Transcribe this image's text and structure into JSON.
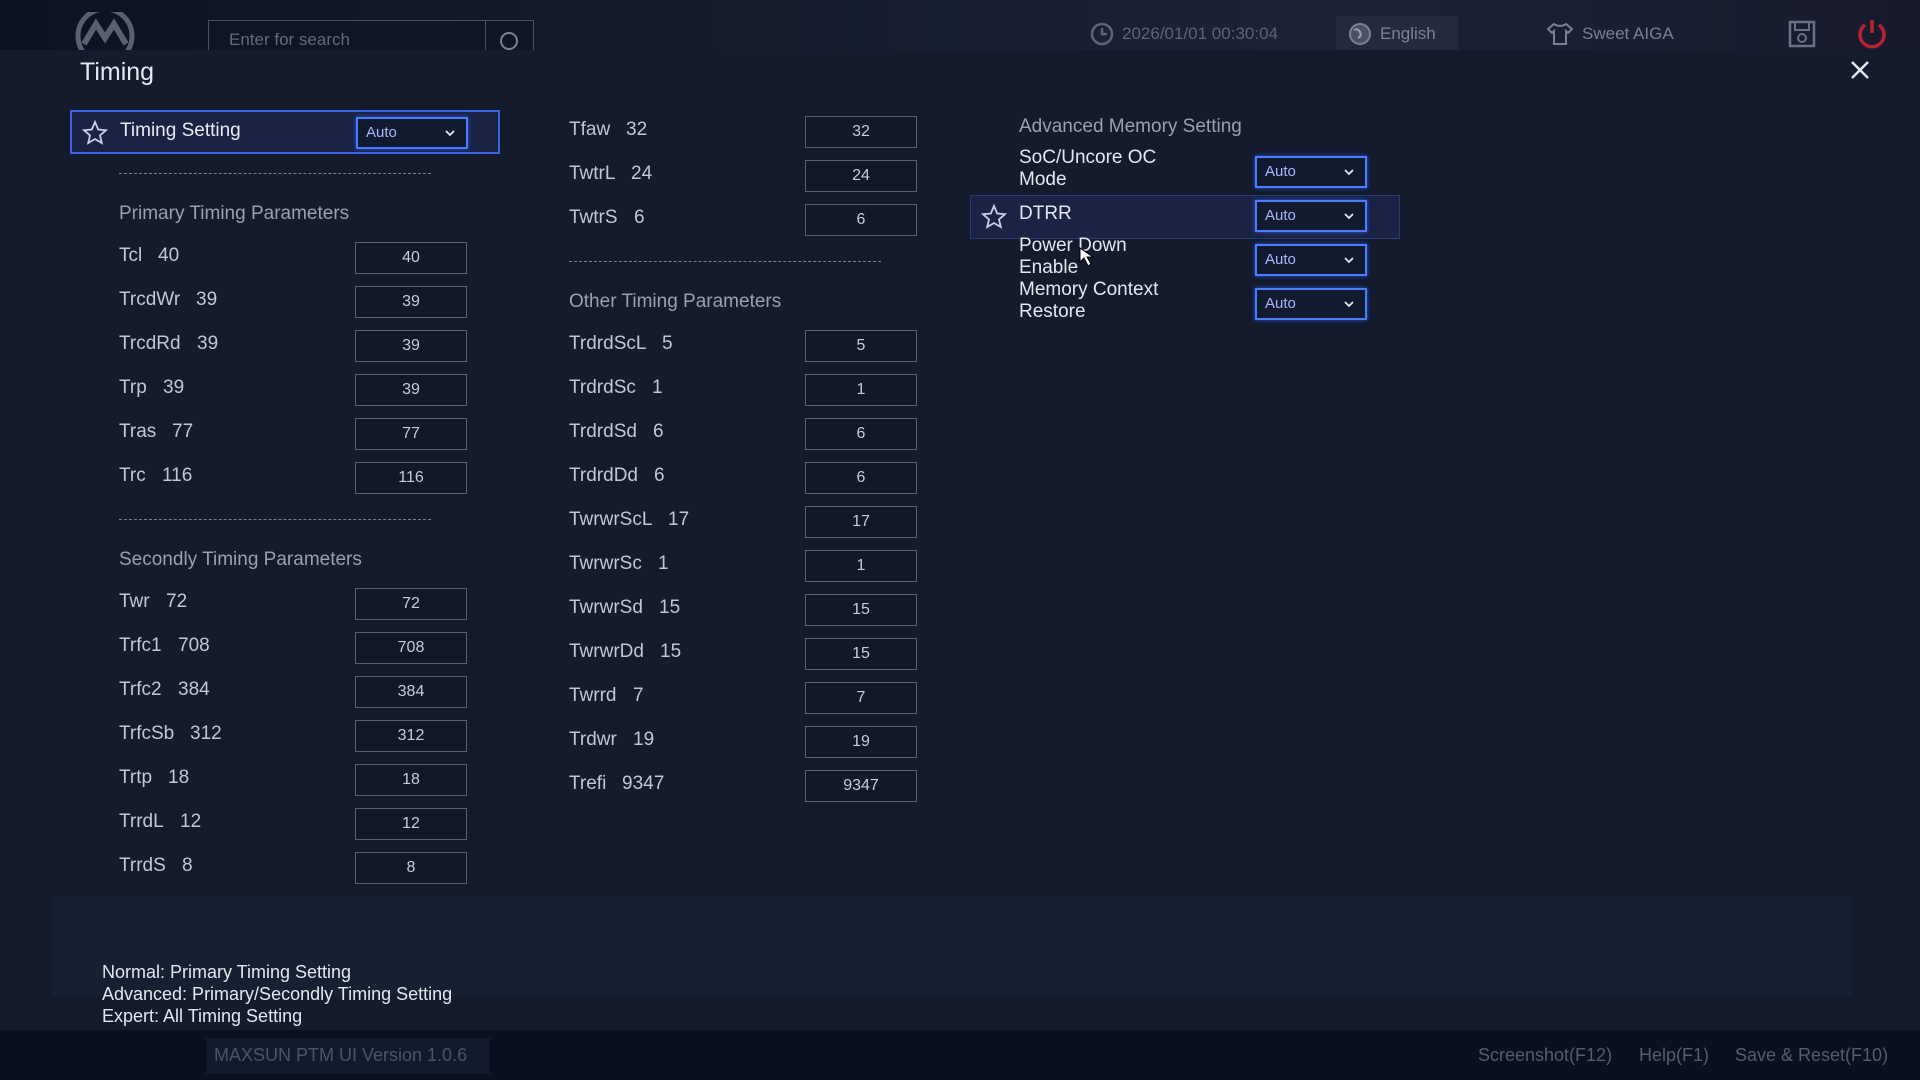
{
  "header": {
    "search_placeholder": "Enter for search",
    "datetime": "2026/01/01 00:30:04",
    "language": "English",
    "theme": "Sweet AIGA",
    "icons": [
      "logo-icon",
      "search-icon",
      "clock-icon",
      "globe-icon",
      "shirt-icon",
      "save-icon",
      "power-icon"
    ]
  },
  "panel": {
    "title": "Timing",
    "timing_setting": {
      "label": "Timing Setting",
      "value": "Auto"
    },
    "primary_title": "Primary Timing Parameters",
    "primary": [
      {
        "name": "Tcl",
        "val": "40",
        "box": "40"
      },
      {
        "name": "TrcdWr",
        "val": "39",
        "box": "39"
      },
      {
        "name": "TrcdRd",
        "val": "39",
        "box": "39"
      },
      {
        "name": "Trp",
        "val": "39",
        "box": "39"
      },
      {
        "name": "Tras",
        "val": "77",
        "box": "77"
      },
      {
        "name": "Trc",
        "val": "116",
        "box": "116"
      }
    ],
    "secondly_title": "Secondly Timing Parameters",
    "secondly": [
      {
        "name": "Twr",
        "val": "72",
        "box": "72"
      },
      {
        "name": "Trfc1",
        "val": "708",
        "box": "708"
      },
      {
        "name": "Trfc2",
        "val": "384",
        "box": "384"
      },
      {
        "name": "TrfcSb",
        "val": "312",
        "box": "312"
      },
      {
        "name": "Trtp",
        "val": "18",
        "box": "18"
      },
      {
        "name": "TrrdL",
        "val": "12",
        "box": "12"
      },
      {
        "name": "TrrdS",
        "val": "8",
        "box": "8"
      }
    ],
    "mid_top": [
      {
        "name": "Tfaw",
        "val": "32",
        "box": "32"
      },
      {
        "name": "TwtrL",
        "val": "24",
        "box": "24"
      },
      {
        "name": "TwtrS",
        "val": "6",
        "box": "6"
      }
    ],
    "other_title": "Other Timing Parameters",
    "other": [
      {
        "name": "TrdrdScL",
        "val": "5",
        "box": "5"
      },
      {
        "name": "TrdrdSc",
        "val": "1",
        "box": "1"
      },
      {
        "name": "TrdrdSd",
        "val": "6",
        "box": "6"
      },
      {
        "name": "TrdrdDd",
        "val": "6",
        "box": "6"
      },
      {
        "name": "TwrwrScL",
        "val": "17",
        "box": "17"
      },
      {
        "name": "TwrwrSc",
        "val": "1",
        "box": "1"
      },
      {
        "name": "TwrwrSd",
        "val": "15",
        "box": "15"
      },
      {
        "name": "TwrwrDd",
        "val": "15",
        "box": "15"
      },
      {
        "name": "Twrrd",
        "val": "7",
        "box": "7"
      },
      {
        "name": "Trdwr",
        "val": "19",
        "box": "19"
      },
      {
        "name": "Trefi",
        "val": "9347",
        "box": "9347"
      }
    ],
    "advanced_title": "Advanced Memory Setting",
    "advanced": [
      {
        "line1": "SoC/Uncore OC",
        "line2": "Mode",
        "value": "Auto"
      },
      {
        "line1": "DTRR",
        "line2": "",
        "value": "Auto"
      },
      {
        "line1": "Power Down",
        "line2": "Enable",
        "value": "Auto"
      },
      {
        "line1": "Memory Context",
        "line2": "Restore",
        "value": "Auto"
      }
    ],
    "legend": [
      "Normal: Primary Timing Setting",
      "Advanced: Primary/Secondly Timing Setting",
      "Expert: All Timing Setting"
    ]
  },
  "footer": {
    "version": "MAXSUN PTM UI Version 1.0.6",
    "screenshot": "Screenshot(F12)",
    "help": "Help(F1)",
    "save_reset": "Save & Reset(F10)"
  }
}
